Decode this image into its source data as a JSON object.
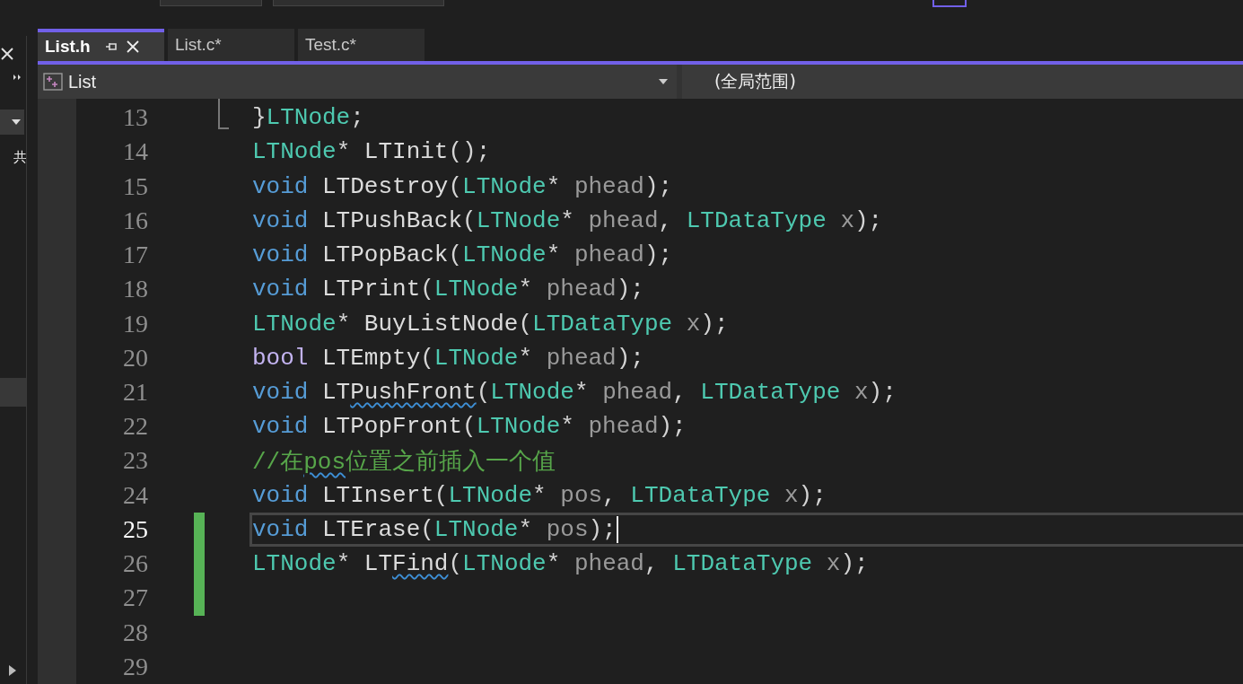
{
  "left_panel": {
    "partial_text": "共"
  },
  "tabs": [
    {
      "label": "List.h",
      "selected": true
    },
    {
      "label": "List.c*",
      "selected": false
    },
    {
      "label": "Test.c*",
      "selected": false
    }
  ],
  "nav_bar": {
    "project": "List",
    "scope": "(全局范围)"
  },
  "lines": [
    {
      "number": "13",
      "changed": false,
      "current": false,
      "tokens": [
        {
          "text": "}",
          "kind": "punct"
        },
        {
          "text": "LTNode",
          "kind": "type"
        },
        {
          "text": ";",
          "kind": "punct"
        }
      ]
    },
    {
      "number": "14",
      "changed": false,
      "current": false,
      "tokens": [
        {
          "text": "LTNode",
          "kind": "type"
        },
        {
          "text": "* ",
          "kind": "punct"
        },
        {
          "text": "LTInit",
          "kind": "fn"
        },
        {
          "text": "();",
          "kind": "punct"
        }
      ]
    },
    {
      "number": "15",
      "changed": false,
      "current": false,
      "tokens": [
        {
          "text": "void ",
          "kind": "kw"
        },
        {
          "text": "LTDestroy",
          "kind": "fn"
        },
        {
          "text": "(",
          "kind": "punct"
        },
        {
          "text": "LTNode",
          "kind": "type"
        },
        {
          "text": "* ",
          "kind": "punct"
        },
        {
          "text": "phead",
          "kind": "param"
        },
        {
          "text": ");",
          "kind": "punct"
        }
      ]
    },
    {
      "number": "16",
      "changed": false,
      "current": false,
      "tokens": [
        {
          "text": "void ",
          "kind": "kw"
        },
        {
          "text": "LTPushBack",
          "kind": "fn"
        },
        {
          "text": "(",
          "kind": "punct"
        },
        {
          "text": "LTNode",
          "kind": "type"
        },
        {
          "text": "* ",
          "kind": "punct"
        },
        {
          "text": "phead",
          "kind": "param"
        },
        {
          "text": ", ",
          "kind": "punct"
        },
        {
          "text": "LTDataType ",
          "kind": "type"
        },
        {
          "text": "x",
          "kind": "param"
        },
        {
          "text": ");",
          "kind": "punct"
        }
      ]
    },
    {
      "number": "17",
      "changed": false,
      "current": false,
      "tokens": [
        {
          "text": "void ",
          "kind": "kw"
        },
        {
          "text": "LTPopBack",
          "kind": "fn"
        },
        {
          "text": "(",
          "kind": "punct"
        },
        {
          "text": "LTNode",
          "kind": "type"
        },
        {
          "text": "* ",
          "kind": "punct"
        },
        {
          "text": "phead",
          "kind": "param"
        },
        {
          "text": ");",
          "kind": "punct"
        }
      ]
    },
    {
      "number": "18",
      "changed": false,
      "current": false,
      "tokens": [
        {
          "text": "void ",
          "kind": "kw"
        },
        {
          "text": "LTPrint",
          "kind": "fn"
        },
        {
          "text": "(",
          "kind": "punct"
        },
        {
          "text": "LTNode",
          "kind": "type"
        },
        {
          "text": "* ",
          "kind": "punct"
        },
        {
          "text": "phead",
          "kind": "param"
        },
        {
          "text": ");",
          "kind": "punct"
        }
      ]
    },
    {
      "number": "19",
      "changed": false,
      "current": false,
      "tokens": [
        {
          "text": "LTNode",
          "kind": "type"
        },
        {
          "text": "* ",
          "kind": "punct"
        },
        {
          "text": "BuyListNode",
          "kind": "fn"
        },
        {
          "text": "(",
          "kind": "punct"
        },
        {
          "text": "LTDataType ",
          "kind": "type"
        },
        {
          "text": "x",
          "kind": "param"
        },
        {
          "text": ");",
          "kind": "punct"
        }
      ]
    },
    {
      "number": "20",
      "changed": false,
      "current": false,
      "tokens": [
        {
          "text": "bool ",
          "kind": "builtin"
        },
        {
          "text": "LTEmpty",
          "kind": "fn"
        },
        {
          "text": "(",
          "kind": "punct"
        },
        {
          "text": "LTNode",
          "kind": "type"
        },
        {
          "text": "* ",
          "kind": "punct"
        },
        {
          "text": "phead",
          "kind": "param"
        },
        {
          "text": ");",
          "kind": "punct"
        }
      ]
    },
    {
      "number": "21",
      "changed": false,
      "current": false,
      "tokens": [
        {
          "text": "void ",
          "kind": "kw"
        },
        {
          "text": "LT",
          "kind": "fn"
        },
        {
          "text": "PushFront",
          "kind": "fn-err"
        },
        {
          "text": "(",
          "kind": "punct"
        },
        {
          "text": "LTNode",
          "kind": "type"
        },
        {
          "text": "* ",
          "kind": "punct"
        },
        {
          "text": "phead",
          "kind": "param"
        },
        {
          "text": ", ",
          "kind": "punct"
        },
        {
          "text": "LTDataType ",
          "kind": "type"
        },
        {
          "text": "x",
          "kind": "param"
        },
        {
          "text": ");",
          "kind": "punct"
        }
      ]
    },
    {
      "number": "22",
      "changed": false,
      "current": false,
      "tokens": [
        {
          "text": "void ",
          "kind": "kw"
        },
        {
          "text": "LTPopFront",
          "kind": "fn"
        },
        {
          "text": "(",
          "kind": "punct"
        },
        {
          "text": "LTNode",
          "kind": "type"
        },
        {
          "text": "* ",
          "kind": "punct"
        },
        {
          "text": "phead",
          "kind": "param"
        },
        {
          "text": ");",
          "kind": "punct"
        }
      ]
    },
    {
      "number": "23",
      "changed": false,
      "current": false,
      "tokens": [
        {
          "text": "//在",
          "kind": "comment"
        },
        {
          "text": "pos",
          "kind": "comment-err"
        },
        {
          "text": "位置之前插入一个值",
          "kind": "comment"
        }
      ]
    },
    {
      "number": "24",
      "changed": false,
      "current": false,
      "tokens": [
        {
          "text": "void ",
          "kind": "kw"
        },
        {
          "text": "LTInsert",
          "kind": "fn"
        },
        {
          "text": "(",
          "kind": "punct"
        },
        {
          "text": "LTNode",
          "kind": "type"
        },
        {
          "text": "* ",
          "kind": "punct"
        },
        {
          "text": "pos",
          "kind": "param"
        },
        {
          "text": ", ",
          "kind": "punct"
        },
        {
          "text": "LTDataType ",
          "kind": "type"
        },
        {
          "text": "x",
          "kind": "param"
        },
        {
          "text": ");",
          "kind": "punct"
        }
      ]
    },
    {
      "number": "25",
      "changed": true,
      "current": true,
      "tokens": [
        {
          "text": "void ",
          "kind": "kw"
        },
        {
          "text": "LTErase",
          "kind": "fn"
        },
        {
          "text": "(",
          "kind": "punct"
        },
        {
          "text": "LTNode",
          "kind": "type"
        },
        {
          "text": "* ",
          "kind": "punct"
        },
        {
          "text": "pos",
          "kind": "param"
        },
        {
          "text": ");",
          "kind": "punct"
        }
      ]
    },
    {
      "number": "26",
      "changed": true,
      "current": false,
      "tokens": [
        {
          "text": "LTNode",
          "kind": "type"
        },
        {
          "text": "* ",
          "kind": "punct"
        },
        {
          "text": "LT",
          "kind": "fn"
        },
        {
          "text": "Find",
          "kind": "fn-err"
        },
        {
          "text": "(",
          "kind": "punct"
        },
        {
          "text": "LTNode",
          "kind": "type"
        },
        {
          "text": "* ",
          "kind": "punct"
        },
        {
          "text": "phead",
          "kind": "param"
        },
        {
          "text": ", ",
          "kind": "punct"
        },
        {
          "text": "LTDataType ",
          "kind": "type"
        },
        {
          "text": "x",
          "kind": "param"
        },
        {
          "text": ");",
          "kind": "punct"
        }
      ]
    },
    {
      "number": "27",
      "changed": true,
      "current": false
    },
    {
      "number": "28",
      "changed": false,
      "current": false
    },
    {
      "number": "29",
      "changed": false,
      "current": false
    }
  ]
}
